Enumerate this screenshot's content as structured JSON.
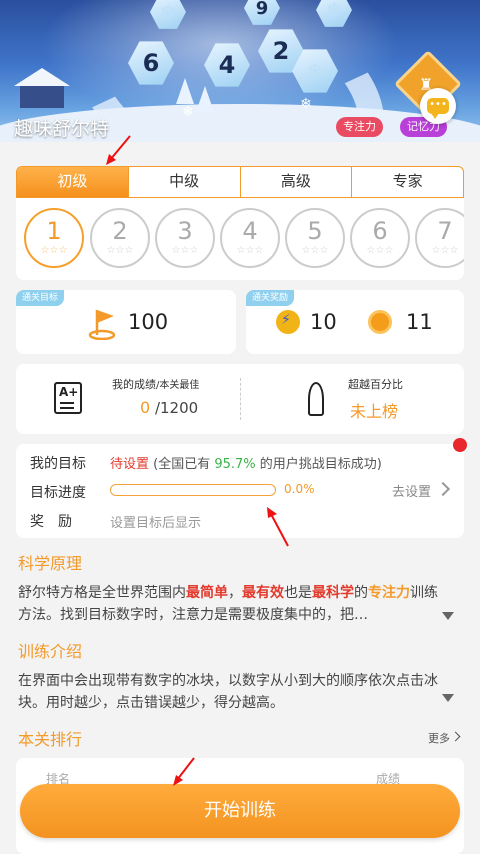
{
  "header": {
    "title": "趣味舒尔特",
    "tags": [
      "专注力",
      "记忆力"
    ],
    "hex_numbers": [
      "9",
      "6",
      "4",
      "2"
    ],
    "chat_icon": "chat-bubble-icon",
    "badge_icon": "trophy-badge-icon"
  },
  "levels": {
    "tabs": [
      "初级",
      "中级",
      "高级",
      "专家"
    ],
    "active_tab": 0,
    "circles": [
      "1",
      "2",
      "3",
      "4",
      "5",
      "6",
      "7"
    ],
    "active_circle": 0,
    "stars": "☆☆☆"
  },
  "goal": {
    "label": "通关目标",
    "value": "100",
    "icon": "flag-icon"
  },
  "reward": {
    "label": "通关奖励",
    "energy": "10",
    "coins": "11"
  },
  "score": {
    "caption_main": "我的成绩",
    "caption_sub": "/本关最佳",
    "current": "0",
    "best": " /1200",
    "pct_caption": "超越百分比",
    "pct_value": "未上榜"
  },
  "target": {
    "my_goal_label": "我的目标",
    "status_red": "待设置",
    "status_pre": " (全国已有 ",
    "status_pct": "95.7%",
    "status_post": " 的用户挑战目标成功)",
    "progress_label": "目标进度",
    "progress_value": 0.0,
    "progress_text": "0.0%",
    "set_link": "去设置",
    "reward_label": "奖　励",
    "reward_hint": "设置目标后显示"
  },
  "science": {
    "title": "科学原理",
    "p1": "舒尔特方格是全世界范围内",
    "p2": "最简单",
    "p3": "，",
    "p4": "最有效",
    "p5": "也是",
    "p6": "最科学",
    "p7": "的",
    "p8": "专注力",
    "p9": "训练方法。找到目标数字时，注意力是需要极度集中的，把…"
  },
  "intro": {
    "title": "训练介绍",
    "body": "在界面中会出现带有数字的冰块，以数字从小到大的顺序依次点击冰块。用时越少，点击错误越少，得分越高。"
  },
  "ranking": {
    "title": "本关排行",
    "more": "更多",
    "col1": "排名",
    "col2": "成绩"
  },
  "start_button": "开始训练",
  "colors": {
    "accent": "#f39a2a",
    "danger": "#e23a2d",
    "success": "#3bb34a"
  }
}
